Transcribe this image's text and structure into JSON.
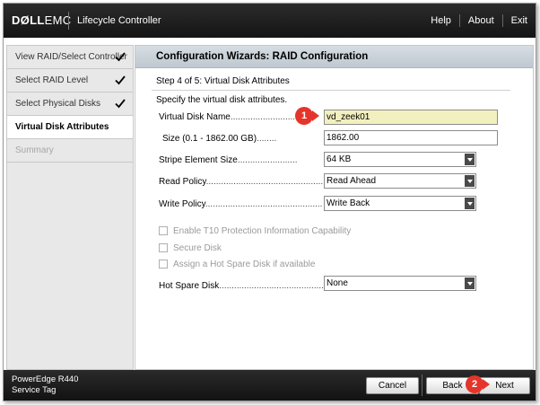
{
  "header": {
    "brand_dell": "DØLL",
    "brand_emc": "EMC",
    "app_name": "Lifecycle Controller",
    "nav": [
      "Help",
      "About",
      "Exit"
    ]
  },
  "sidebar": {
    "items": [
      {
        "label": "View RAID/Select Controller",
        "state": "done"
      },
      {
        "label": "Select RAID Level",
        "state": "done"
      },
      {
        "label": "Select Physical Disks",
        "state": "done"
      },
      {
        "label": "Virtual Disk Attributes",
        "state": "active"
      },
      {
        "label": "Summary",
        "state": "disabled"
      }
    ]
  },
  "main": {
    "title": "Configuration Wizards: RAID Configuration",
    "step": "Step 4 of 5: Virtual Disk Attributes",
    "intro": "Specify the virtual disk attributes.",
    "fields": {
      "name": {
        "label": "Virtual Disk Name",
        "value": "vd_zeek01"
      },
      "size": {
        "label": "Size (0.1 - 1862.00 GB)",
        "value": "1862.00"
      },
      "stripe": {
        "label": "Stripe Element Size",
        "value": "64 KB"
      },
      "read": {
        "label": "Read Policy",
        "value": "Read Ahead"
      },
      "write": {
        "label": "Write Policy",
        "value": "Write Back"
      },
      "hotspare": {
        "label": "Hot Spare Disk",
        "value": "None"
      }
    },
    "options": {
      "t10": "Enable T10 Protection Information Capability",
      "secure": "Secure Disk",
      "hotspare_assign": "Assign a Hot Spare Disk if available"
    },
    "dots": "..........................",
    "callouts": [
      "1",
      "2"
    ]
  },
  "footer": {
    "model": "PowerEdge R440",
    "service_tag": "Service Tag",
    "cancel": "Cancel",
    "back": "Back",
    "next": "Next"
  },
  "colors": {
    "callout": "#e5352a",
    "highlight_field": "#f3f0c0",
    "title_bar": "#c9d1d8"
  }
}
